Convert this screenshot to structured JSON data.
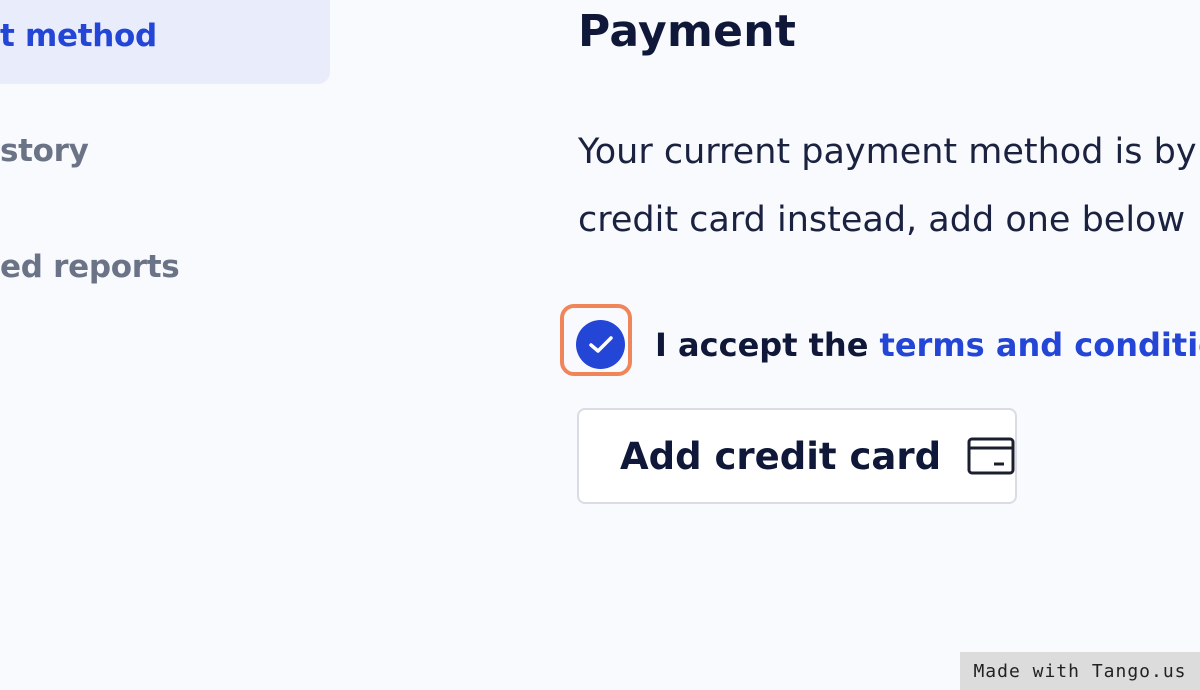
{
  "sidebar": {
    "items": [
      {
        "label": "t method",
        "active": true
      },
      {
        "label": "story",
        "active": false
      },
      {
        "label": "ed reports",
        "active": false
      }
    ]
  },
  "main": {
    "title": "Payment",
    "description_lines": [
      "Your current payment method is by",
      "credit card instead, add one below"
    ],
    "terms": {
      "checked": true,
      "prefix": "I accept the",
      "link_text": "terms and conditions"
    },
    "add_card_button": {
      "label": "Add credit card",
      "icon": "credit-card-icon"
    }
  },
  "watermark": "Made with Tango.us",
  "colors": {
    "accent": "#2346d6",
    "highlight": "#f0855a",
    "background": "#f9fafe",
    "sidebar_active_bg": "#e9edfb"
  }
}
